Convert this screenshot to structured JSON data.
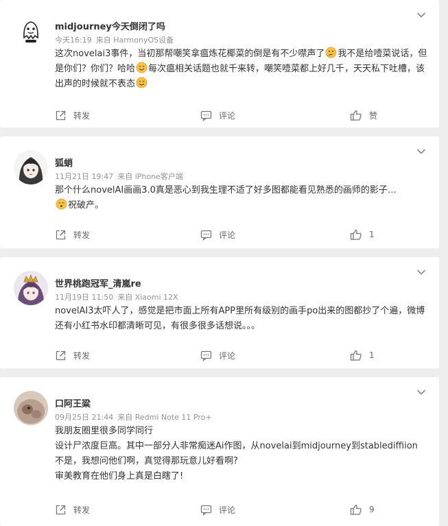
{
  "posts": [
    {
      "username": "midjourney今天倒闭了吗",
      "time": "今天16:19",
      "source": "来自 HarmonyOS设备",
      "content": [
        [
          {
            "t": "text",
            "v": "这次novelai3事件，当初那帮嘲笑拿瘟炼花椰菜的倒是有不少噤声了"
          },
          {
            "t": "emoji",
            "v": "thinking-emoji"
          },
          {
            "t": "text",
            "v": "我不是给噎菜说话，但是你们？你们？哈哈"
          },
          {
            "t": "emoji",
            "v": "smile-emoji"
          },
          {
            "t": "text",
            "v": "每次瘟相关话题也就千来转，嘲笑噎菜都上好几千，天天私下吐槽，该出声的时候就不表态"
          },
          {
            "t": "emoji",
            "v": "smile-emoji"
          }
        ]
      ],
      "actions": {
        "repost": "转发",
        "comment": "评论",
        "like": "赞"
      }
    },
    {
      "username": "狐蛸",
      "time": "11月21日 19:47",
      "source": "来自 iPhone客户端",
      "content": [
        [
          {
            "t": "text",
            "v": "那个什么novelAI画画3.0真是恶心到我生理不适了好多图都能看见熟悉的画师的影子…"
          }
        ],
        [
          {
            "t": "emoji",
            "v": "pray-emoji"
          },
          {
            "t": "text",
            "v": "祝破产。"
          }
        ]
      ],
      "actions": {
        "repost": "转发",
        "comment": "评论",
        "like": "1"
      }
    },
    {
      "username": "世界桃跑冠军_清嵐re",
      "time": "11月19日 11:50",
      "source": "来自 Xiaomi 12X",
      "content": [
        [
          {
            "t": "text",
            "v": "novelAI3太吓人了，感觉是把市面上所有APP里所有级别的画手po出来的图都抄了个遍，微博还有小红书水印都清晰可见，有很多很多话想说。。。"
          }
        ]
      ],
      "actions": {
        "repost": "转发",
        "comment": "评论",
        "like": "1"
      }
    },
    {
      "username": "口阿王粱",
      "time": "09月25日 21:44",
      "source": "来自 Redmi Note 11 Pro+",
      "content": [
        [
          {
            "t": "text",
            "v": "我朋友圈里很多同学同行"
          }
        ],
        [
          {
            "t": "text",
            "v": "设计尸浓度巨高。其中一部分人非常痴迷Ai作图，从novelai到midjourney到stablediffiion"
          }
        ],
        [
          {
            "t": "text",
            "v": "不是，我想问他们啊，真觉得那玩意儿好看啊?"
          }
        ],
        [
          {
            "t": "text",
            "v": "审美教育在他们身上真是白瞎了!"
          }
        ]
      ],
      "actions": {
        "repost": "转发",
        "comment": "评论",
        "like": "9"
      }
    }
  ],
  "avatars": [
    "ghost-doodle-avatar",
    "anime-girl-avatar",
    "crowned-anime-avatar",
    "cat-photo-avatar"
  ],
  "colors": {
    "background": "#eeeeee",
    "card": "#ffffff",
    "username": "#333333",
    "meta": "#939393",
    "content": "#333333",
    "action": "#666666",
    "emoji": "#f6c14a"
  }
}
